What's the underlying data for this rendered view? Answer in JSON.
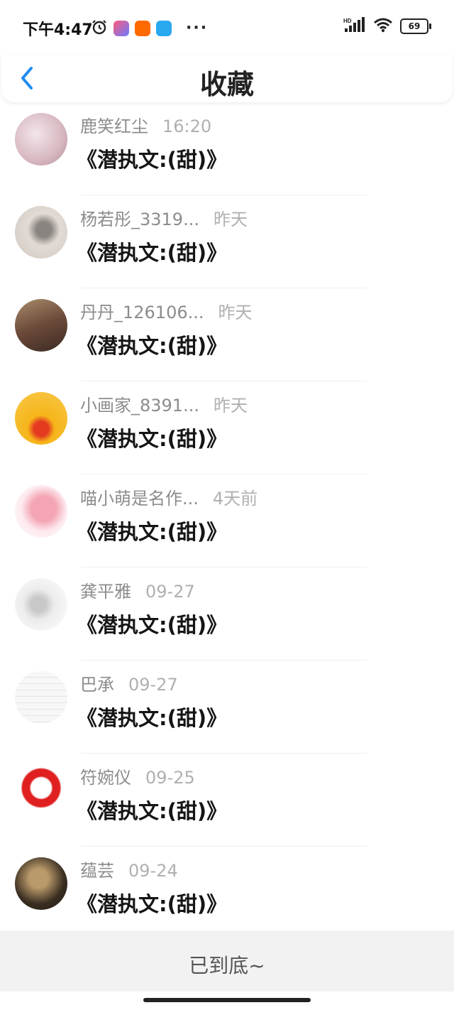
{
  "status_bar": {
    "time": "下午4:47",
    "battery": "69",
    "network": "HD"
  },
  "header": {
    "title": "收藏"
  },
  "items": [
    {
      "name": "鹿笑红尘",
      "time": "16:20",
      "msg": "《潜执文:(甜)》",
      "avatar_color": "#d7b7c0",
      "avatar_color2": "#f2e6ea"
    },
    {
      "name": "杨若彤_3319...",
      "time": "昨天",
      "msg": "《潜执文:(甜)》",
      "avatar_color": "#ddd5cf",
      "avatar_color2": "#8a8480"
    },
    {
      "name": "丹丹_126106...",
      "time": "昨天",
      "msg": "《潜执文:(甜)》",
      "avatar_color": "#6c4a3a",
      "avatar_color2": "#a88c6a"
    },
    {
      "name": "小画家_8391...",
      "time": "昨天",
      "msg": "《潜执文:(甜)》",
      "avatar_color": "#f6b51a",
      "avatar_color2": "#e43b20"
    },
    {
      "name": "喵小萌是名作...",
      "time": "4天前",
      "msg": "《潜执文:(甜)》",
      "avatar_color": "#f4a5b4",
      "avatar_color2": "#ffffff"
    },
    {
      "name": "龚平雅",
      "time": "09-27",
      "msg": "《潜执文:(甜)》",
      "avatar_color": "#e6e6e6",
      "avatar_color2": "#ffffff"
    },
    {
      "name": "巴承",
      "time": "09-27",
      "msg": "《潜执文:(甜)》",
      "avatar_color": "#f4f4f4",
      "avatar_color2": "#ffffff"
    },
    {
      "name": "符婉仪",
      "time": "09-25",
      "msg": "《潜执文:(甜)》",
      "avatar_color": "#e02020",
      "avatar_color2": "#ffffff"
    },
    {
      "name": "蕴芸",
      "time": "09-24",
      "msg": "《潜执文:(甜)》",
      "avatar_color": "#3a2e22",
      "avatar_color2": "#b99a6a"
    }
  ],
  "footer": {
    "text": "已到底~"
  },
  "colors": {
    "accent": "#1e8cf0",
    "name_gray": "#8c8c8c",
    "time_gray": "#b0b0b0"
  }
}
